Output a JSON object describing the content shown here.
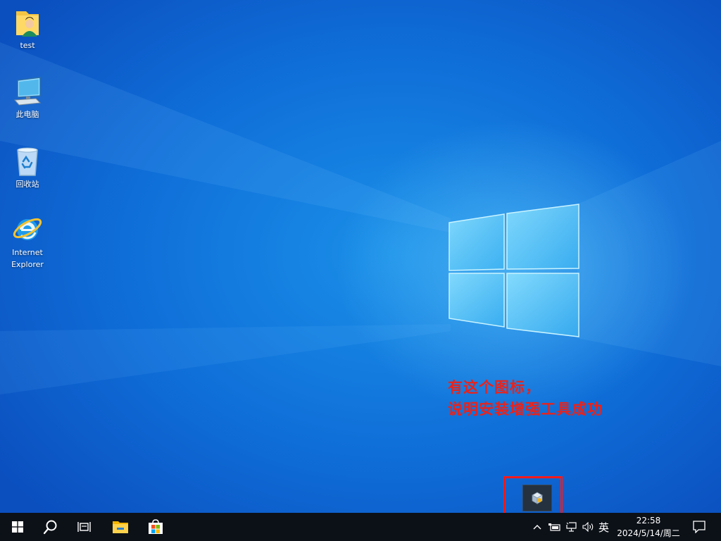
{
  "desktop_icons": [
    {
      "label": "test",
      "icon": "user-folder-icon"
    },
    {
      "label": "此电脑",
      "icon": "this-pc-icon"
    },
    {
      "label": "回收站",
      "icon": "recycle-bin-icon"
    },
    {
      "label_line1": "Internet",
      "label_line2": "Explorer",
      "icon": "internet-explorer-icon"
    }
  ],
  "annotation": {
    "line1": "有这个图标，",
    "line2": "说明安装增强工具成功",
    "color": "#e8231c"
  },
  "taskbar": {
    "icons": [
      "windows-start-icon",
      "search-icon",
      "task-view-icon",
      "file-explorer-icon",
      "microsoft-store-icon"
    ],
    "tray": {
      "input_method": "英",
      "time": "22:58",
      "date": "2024/5/14/周二"
    }
  },
  "colors": {
    "taskbar": "#0c1118",
    "highlight_box": "#ff1a1a"
  }
}
